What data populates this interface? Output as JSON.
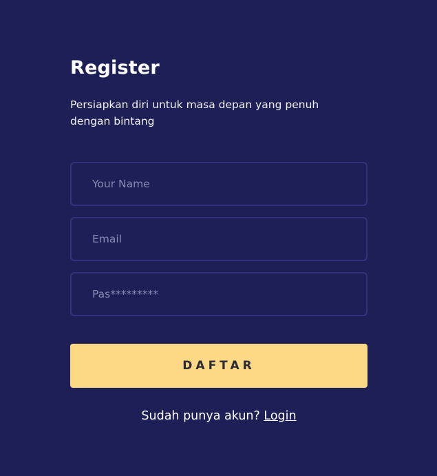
{
  "register": {
    "title": "Register",
    "subtitle": "Persiapkan diri untuk masa depan yang penuh dengan bintang",
    "name_placeholder": "Your Name",
    "email_placeholder": "Email",
    "password_placeholder": "Pas*********",
    "submit_label": "DAFTAR",
    "footer_text": "Sudah punya akun?",
    "login_link": "Login"
  },
  "colors": {
    "background": "#1e1f57",
    "button": "#fdd985",
    "field_border": "#32347a"
  }
}
